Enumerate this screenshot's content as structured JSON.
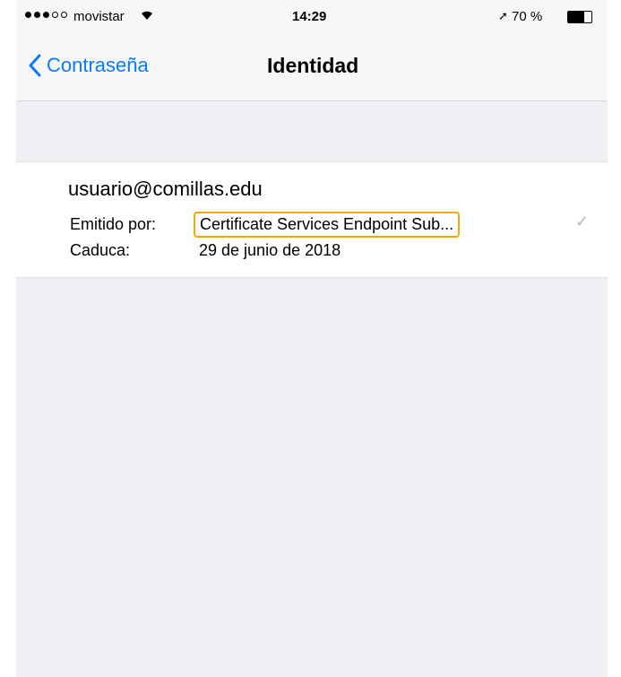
{
  "status_bar": {
    "carrier": "movistar",
    "time": "14:29",
    "battery_percent": "70 %",
    "battery_level": 0.7,
    "signal_bars_filled": 3,
    "signal_bars_total": 5
  },
  "nav": {
    "back_label": "Contraseña",
    "title": "Identidad"
  },
  "identity": {
    "email": "usuario@comillas.edu",
    "issuer_label": "Emitido por:",
    "issuer_value": "Certificate Services Endpoint Sub...",
    "expiry_label": "Caduca:",
    "expiry_value": "29 de junio de 2018",
    "selected": true
  },
  "colors": {
    "accent": "#0a7aff",
    "highlight": "#f2a900",
    "background": "#efeff4"
  },
  "icons": [
    "signal-dots-icon",
    "wifi-icon",
    "location-icon",
    "battery-icon",
    "chevron-left-icon",
    "checkmark-icon"
  ]
}
